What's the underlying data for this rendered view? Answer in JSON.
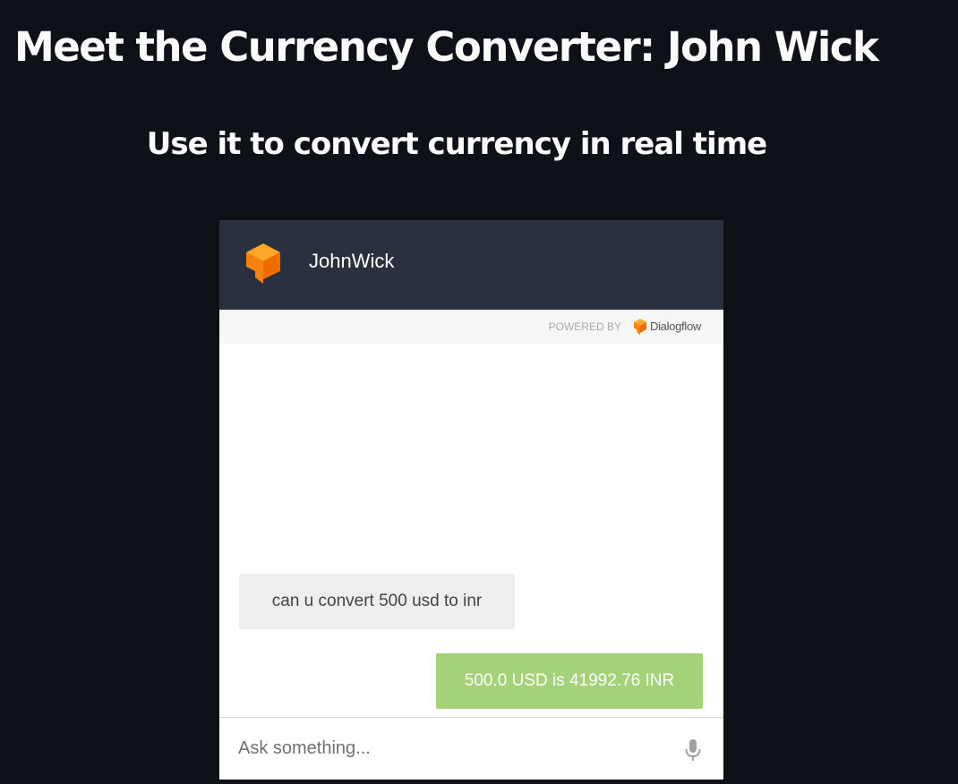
{
  "page": {
    "title": "Meet the Currency Converter: John Wick",
    "subtitle": "Use it to convert currency in real time"
  },
  "chat": {
    "header": {
      "agent_name": "JohnWick",
      "avatar_icon": "dialogflow-cube-icon"
    },
    "powered_by": {
      "label": "POWERED BY",
      "brand": "Dialogflow",
      "brand_icon": "dialogflow-logo-icon"
    },
    "messages": [
      {
        "role": "user",
        "text": "can u convert 500 usd to inr"
      },
      {
        "role": "bot",
        "text": "500.0 USD is 41992.76 INR"
      }
    ],
    "input": {
      "placeholder": "Ask something...",
      "value": "",
      "mic_icon": "microphone-icon"
    }
  },
  "colors": {
    "page_background": "#0e1117",
    "heading_text": "#fafafa",
    "chat_header": "#2a303e",
    "brand_orange": "#f6830e",
    "user_bubble": "#eeeeee",
    "bot_bubble": "#a4d278"
  }
}
